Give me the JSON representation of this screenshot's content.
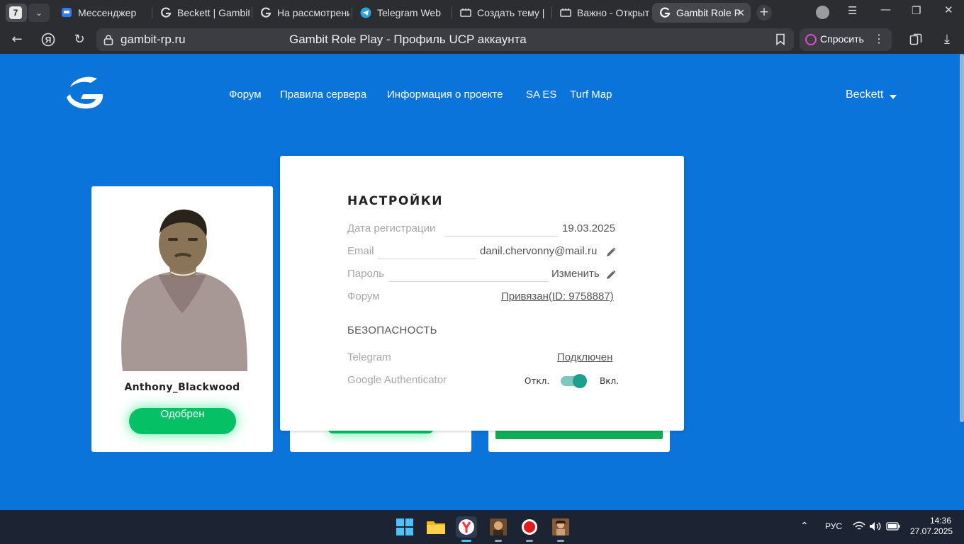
{
  "browser": {
    "tab_count": "7",
    "tabs": [
      {
        "label": "Мессенджер"
      },
      {
        "label": "Beckett | Gambit"
      },
      {
        "label": "На рассмотрени"
      },
      {
        "label": "Telegram Web"
      },
      {
        "label": "Создать тему | "
      },
      {
        "label": "Важно - Открыт"
      },
      {
        "label": "Gambit Role P",
        "active": true
      }
    ],
    "url": "gambit-rp.ru",
    "page_title": "Gambit Role Play - Профиль UCP аккаунта",
    "ask_label": "Спросить"
  },
  "nav": {
    "items": [
      "Форум",
      "Правила сервера",
      "Информация о проекте",
      "SA ES",
      "Turf Map"
    ],
    "user": "Beckett"
  },
  "character": {
    "name": "Anthony_Blackwood",
    "status_label": "Одобрен"
  },
  "settings": {
    "title": "НАСТРОЙКИ",
    "reg_label": "Дата регистрации",
    "reg_value": "19.03.2025",
    "email_label": "Email",
    "email_value": "danil.chervonny@mail.ru",
    "password_label": "Пароль",
    "password_value": "Изменить",
    "forum_label": "Форум",
    "forum_value": "Привязан(ID: 9758887)",
    "security_title": "БЕЗОПАСНОСТЬ",
    "telegram_label": "Telegram",
    "telegram_value": "Подключен",
    "ga_label": "Google Authenticator",
    "ga_off": "Откл.",
    "ga_on": "Вкл.",
    "ga_enabled": true
  },
  "taskbar": {
    "lang": "РУС",
    "time": "14:36",
    "date": "27.07.2025"
  },
  "colors": {
    "page_bg": "#0a74da",
    "success_green": "#06c066",
    "toggle_on": "#1e9e8c"
  }
}
